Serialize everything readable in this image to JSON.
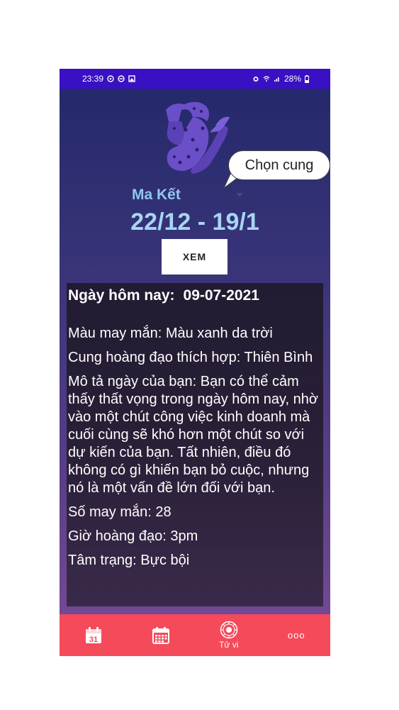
{
  "status_bar": {
    "time": "23:39",
    "battery": "28%"
  },
  "tooltip": "Chọn cung",
  "sign": {
    "name": "Ma Kết",
    "date_range": "22/12 - 19/1"
  },
  "view_button": "XEM",
  "horoscope": {
    "today_label": "Ngày hôm nay:",
    "today_date": "09-07-2021",
    "lucky_color": "Màu may mắn: Màu xanh da trời",
    "compatible_sign": "Cung hoàng đạo thích hợp: Thiên Bình",
    "description": "Mô tả ngày của bạn: Bạn có thể cảm thấy thất vọng trong ngày hôm nay, nhờ vào một chút công việc kinh doanh mà cuối cùng sẽ khó hơn một chút so với dự kiến của bạn. Tất nhiên, điều đó không có gì khiến bạn bỏ cuộc, nhưng nó là một vấn đề lớn đối với bạn.",
    "lucky_number": "Số may mắn: 28",
    "lucky_hour": "Giờ hoàng đạo: 3pm",
    "mood": "Tâm trạng: Bực bội"
  },
  "bottom_nav": {
    "calendar_day": "31",
    "tuvi_label": "Tử vi",
    "more_label": "ooo"
  },
  "colors": {
    "status_bar": "#3a10c4",
    "nav_bar": "#f54a5a",
    "date_text": "#a6d6f2",
    "sign_art": "#6b4fc8"
  }
}
